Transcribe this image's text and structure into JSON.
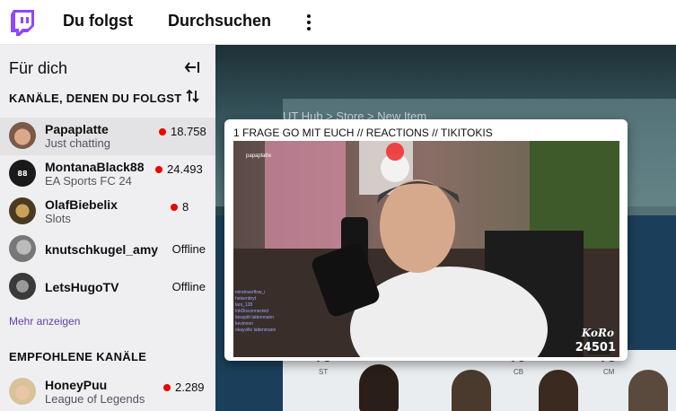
{
  "colors": {
    "brand": "#9146ff",
    "live": "#eb0400",
    "link": "#6441a5",
    "sidebar_bg": "#efeff1"
  },
  "topnav": {
    "logo_icon": "twitch-glitch-icon",
    "following_label": "Du folgst",
    "browse_label": "Durchsuchen",
    "more_icon": "vertical-ellipsis-icon"
  },
  "sidebar": {
    "title": "Für dich",
    "collapse_icon": "collapse-arrow-icon",
    "followed_heading": "KANÄLE, DENEN DU FOLGST",
    "sort_icon": "sort-arrows-icon",
    "followed": [
      {
        "name": "Papaplatte",
        "category": "Just chatting",
        "viewers": "18.758",
        "live": true
      },
      {
        "name": "MontanaBlack88",
        "category": "EA Sports FC 24",
        "viewers": "24.493",
        "live": true
      },
      {
        "name": "OlafBiebelix",
        "category": "Slots",
        "viewers": "8",
        "live": true
      },
      {
        "name": "knutschkugel_amy",
        "status": "Offline",
        "live": false
      },
      {
        "name": "LetsHugoTV",
        "status": "Offline",
        "live": false
      }
    ],
    "show_more": "Mehr anzeigen",
    "recommended_heading": "EMPFOHLENE KANÄLE",
    "recommended": [
      {
        "name": "HoneyPuu",
        "category": "League of Legends",
        "viewers": "2.289",
        "live": true
      }
    ]
  },
  "background": {
    "breadcrumb": "UT Hub > Store > New Item",
    "cards": [
      {
        "rating": "78",
        "position": "ST"
      },
      {
        "rating": "79",
        "position": "CB"
      },
      {
        "rating": "78",
        "position": "CM"
      }
    ]
  },
  "preview": {
    "title": "1 FRAGE GO MIT EUCH // REACTIONS // TIKITOKIS",
    "overlay_logo": "KoRo",
    "overlay_count": "24501",
    "overlay_username": "papaplatte",
    "chat_lines": [
      "mindoverflow_i",
      "heisenbryt",
      "lars_128",
      "InkDisconnected",
      "tiesspitt lattenmann",
      "kevinnnn",
      "okayville lattenmann"
    ]
  }
}
